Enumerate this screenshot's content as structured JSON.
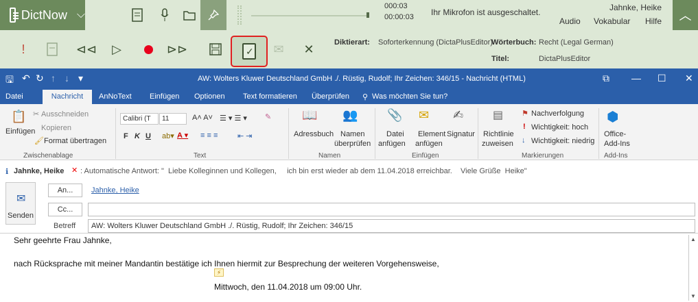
{
  "dictnow": {
    "app_name": "DictNow",
    "time_current": "000:03",
    "time_total": "00:00:03",
    "mic_status": "Ihr Mikrofon ist ausgeschaltet.",
    "user_name": "Jahnke, Heike",
    "menu": [
      "Audio",
      "Vokabular",
      "Hilfe"
    ],
    "diktierart_label": "Diktierart:",
    "diktierart_value": "Soforterkennung (DictaPlusEditor)",
    "woerterbuch_label": "Wörterbuch:",
    "woerterbuch_value": "Recht (Legal German)",
    "titel_label": "Titel:",
    "titel_value": "DictaPlusEditor",
    "accent_color": "#6c8a5c",
    "highlight_color": "#e02020"
  },
  "outlook": {
    "window_title": "AW: Wolters Kluwer Deutschland GmbH ./. Rüstig, Rudolf; Ihr Zeichen: 346/15 - Nachricht (HTML)",
    "tabs": [
      "Datei",
      "Nachricht",
      "AnNoText",
      "Einfügen",
      "Optionen",
      "Text formatieren",
      "Überprüfen"
    ],
    "tell_me": "Was möchten Sie tun?",
    "clipboard": {
      "cut": "Ausschneiden",
      "copy": "Kopieren",
      "paste": "Einfügen",
      "format": "Format übertragen",
      "group": "Zwischenablage"
    },
    "text": {
      "font": "Calibri (T",
      "size": "11",
      "bold": "F",
      "italic": "K",
      "underline": "U",
      "group": "Text"
    },
    "names": {
      "addressbook": "Adressbuch",
      "check_1": "Namen",
      "check_2": "überprüfen",
      "group": "Namen"
    },
    "include": {
      "file_1": "Datei",
      "file_2": "anfügen",
      "item_1": "Element",
      "item_2": "anfügen",
      "signature": "Signatur",
      "group": "Einfügen"
    },
    "tags": {
      "policy_1": "Richtlinie",
      "policy_2": "zuweisen",
      "followup": "Nachverfolgung",
      "high": "Wichtigkeit: hoch",
      "low": "Wichtigkeit: niedrig",
      "group": "Markierungen"
    },
    "addins": {
      "label_1": "Office-",
      "label_2": "Add-Ins",
      "group": "Add-Ins"
    },
    "autoreply_name": "Jahnke, Heike",
    "autoreply_text": ": Automatische Antwort: \"  Liebe Kolleginnen und Kollegen,     ich bin erst wieder ab dem 11.04.2018 erreichbar.    Viele Grüße  Heike\"",
    "send_label": "Senden",
    "to_label": "An...",
    "cc_label": "Cc...",
    "subject_label": "Betreff",
    "to_value": "Jahnke, Heike",
    "subject_value": "AW: Wolters Kluwer Deutschland GmbH ./. Rüstig, Rudolf; Ihr Zeichen: 346/15",
    "body_line1": "Sehr geehrte Frau Jahnke,",
    "body_line2": "nach Rücksprache mit meiner Mandantin bestätige ich Ihnen hiermit zur Besprechung der weiteren Vorgehensweise,",
    "body_line3": "Mittwoch, den 11.04.2018 um 09:00 Uhr.",
    "accent_color": "#2b5faa"
  }
}
